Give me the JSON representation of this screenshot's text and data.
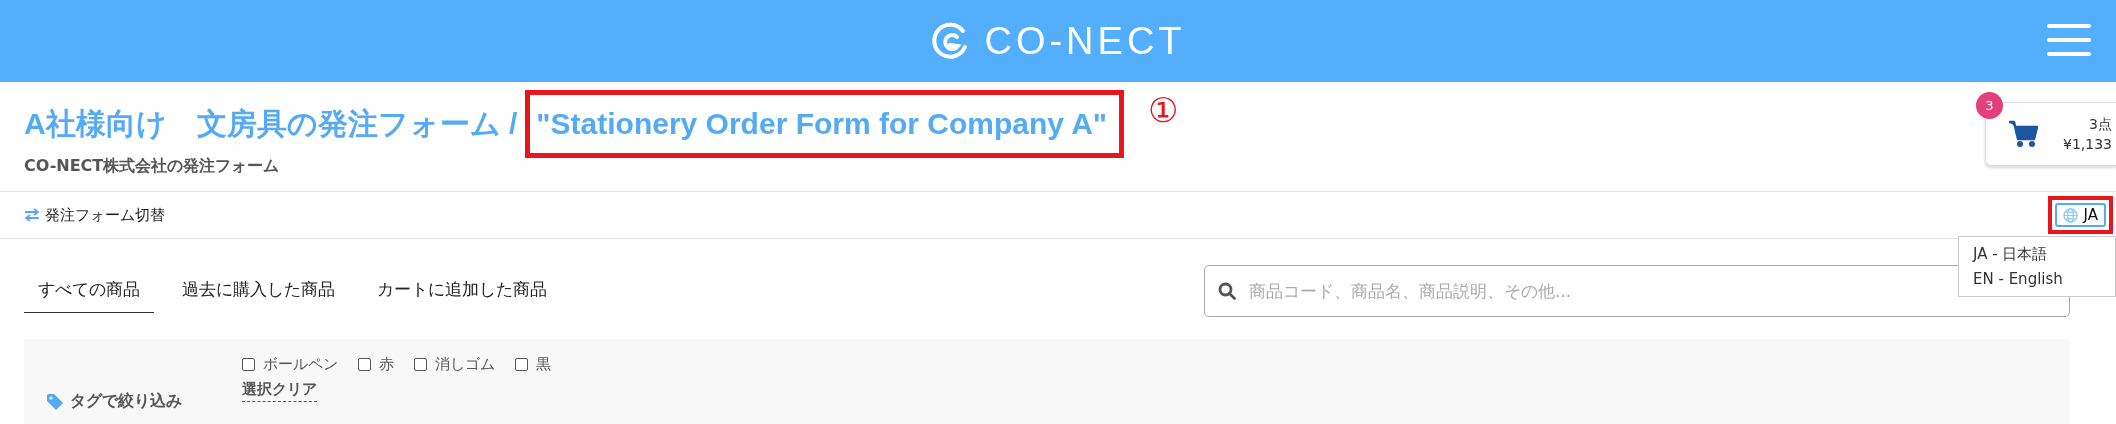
{
  "header": {
    "logo": "CO-NECT"
  },
  "title": {
    "main": "A社様向け　文房具の発注フォーム /",
    "english": "\"Stationery Order Form for Company A\"",
    "annotation": "①",
    "subtitle": "CO-NECT株式会社の発注フォーム"
  },
  "cart": {
    "badge": "3",
    "count": "3点",
    "total": "¥1,133"
  },
  "switch_link": "発注フォーム切替",
  "language": {
    "button": "JA",
    "menu": [
      "JA - 日本語",
      "EN - English"
    ]
  },
  "tabs": [
    {
      "label": "すべての商品",
      "selected": true
    },
    {
      "label": "過去に購入した商品",
      "selected": false
    },
    {
      "label": "カートに追加した商品",
      "selected": false
    }
  ],
  "search": {
    "placeholder": "商品コード、商品名、商品説明、その他..."
  },
  "filter": {
    "label": "タグで絞り込み",
    "clear": "選択クリア",
    "tags": [
      {
        "label": "ボールペン",
        "checked": false
      },
      {
        "label": "赤",
        "checked": false
      },
      {
        "label": "消しゴム",
        "checked": false
      },
      {
        "label": "黒",
        "checked": false
      }
    ]
  }
}
